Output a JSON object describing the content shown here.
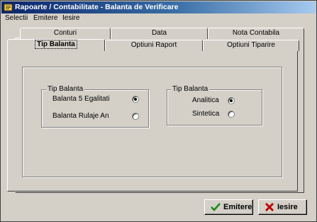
{
  "window": {
    "title": "Rapoarte / Contabilitate - Balanta de Verificare"
  },
  "menu": {
    "items": [
      "Selectii",
      "Emitere",
      "Iesire"
    ]
  },
  "tabs": {
    "back_row": [
      "Conturi",
      "Data",
      "Nota Contabila"
    ],
    "front_row": [
      "Tip Balanta",
      "Optiuni Raport",
      "Optiuni Tiparire"
    ],
    "active": "Tip Balanta"
  },
  "groups": [
    {
      "legend": "Tip Balanta",
      "options": [
        {
          "label": "Balanta 5 Egalitati",
          "checked": true
        },
        {
          "label": "Balanta Rulaje An",
          "checked": false
        }
      ]
    },
    {
      "legend": "Tip Balanta",
      "options": [
        {
          "label": "Analitica",
          "checked": true
        },
        {
          "label": "Sintetica",
          "checked": false
        }
      ]
    }
  ],
  "buttons": {
    "emitere": "Emitere",
    "iesire": "Iesire"
  },
  "icons": {
    "app": "ledger-icon",
    "emitere": "checkmark-icon",
    "iesire": "close-x-icon"
  },
  "colors": {
    "face": "#d4d0c8",
    "title_start": "#0a246a",
    "title_end": "#a6caf0",
    "check": "#1a8a1a",
    "close": "#c00000"
  }
}
